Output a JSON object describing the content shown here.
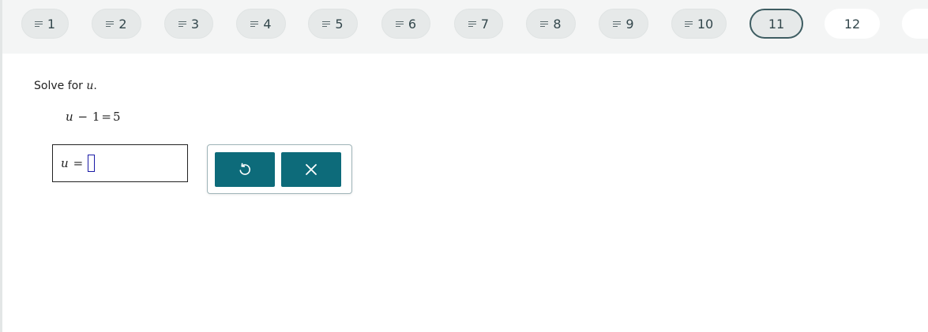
{
  "question_nav": {
    "items": [
      {
        "label": "1",
        "state": "answered"
      },
      {
        "label": "2",
        "state": "answered"
      },
      {
        "label": "3",
        "state": "answered"
      },
      {
        "label": "4",
        "state": "answered"
      },
      {
        "label": "5",
        "state": "answered"
      },
      {
        "label": "6",
        "state": "answered"
      },
      {
        "label": "7",
        "state": "answered"
      },
      {
        "label": "8",
        "state": "answered"
      },
      {
        "label": "9",
        "state": "answered"
      },
      {
        "label": "10",
        "state": "answered"
      },
      {
        "label": "11",
        "state": "current"
      },
      {
        "label": "12",
        "state": "upcoming"
      }
    ]
  },
  "question": {
    "prompt_text": "Solve for ",
    "variable": "u",
    "prompt_end": ".",
    "equation": {
      "lhs_var": "u",
      "minus": "−",
      "num1": "1",
      "equals": "=",
      "num2": "5"
    }
  },
  "answer": {
    "var": "u",
    "equals": "=",
    "value": ""
  },
  "toolbox": {
    "undo_icon": "undo-icon",
    "clear_icon": "close-icon"
  },
  "colors": {
    "accent": "#0d6b7a",
    "nav_current_border": "#3e5d62",
    "topbar_bg": "#f4f5f5"
  }
}
